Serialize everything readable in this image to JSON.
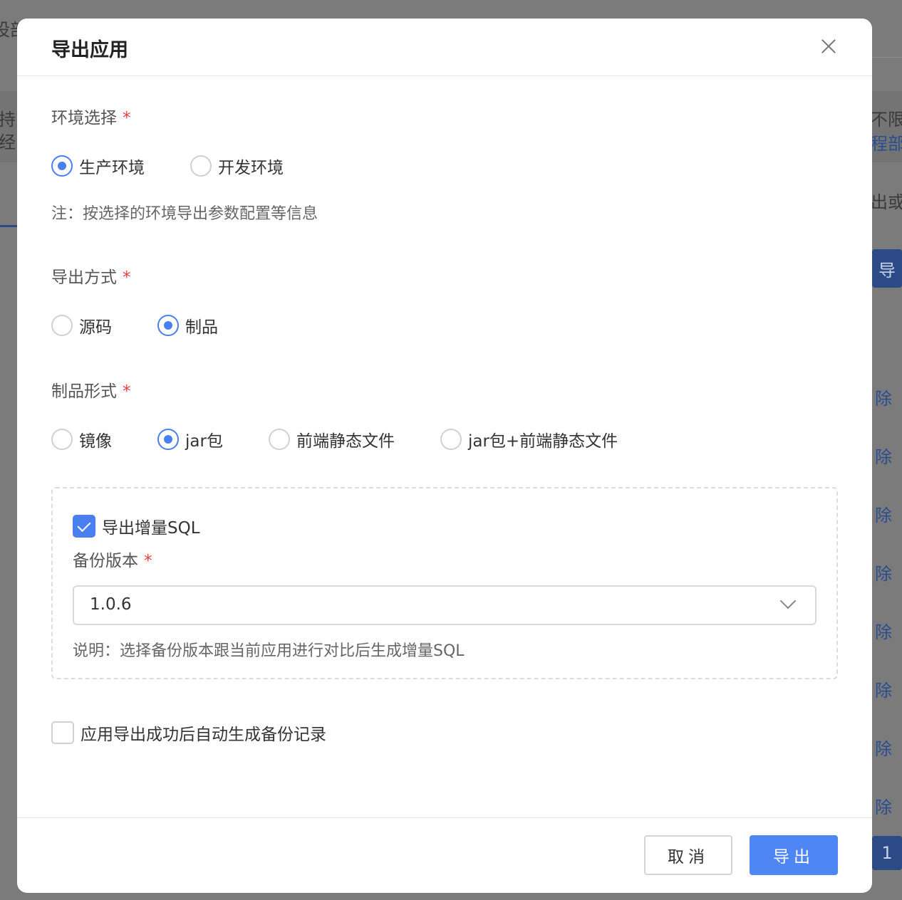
{
  "background": {
    "fragments": [
      "设部",
      "持",
      "经",
      "不限",
      "程部",
      "出或",
      "导",
      "除",
      "除",
      "除",
      "除",
      "除",
      "除",
      "除",
      "除",
      "1"
    ]
  },
  "modal": {
    "title": "导出应用",
    "env": {
      "label": "环境选择",
      "required": "*",
      "options": [
        {
          "label": "生产环境",
          "checked": true
        },
        {
          "label": "开发环境",
          "checked": false
        }
      ],
      "note": "注：按选择的环境导出参数配置等信息"
    },
    "export_method": {
      "label": "导出方式",
      "required": "*",
      "options": [
        {
          "label": "源码",
          "checked": false
        },
        {
          "label": "制品",
          "checked": true
        }
      ]
    },
    "artifact_form": {
      "label": "制品形式",
      "required": "*",
      "options": [
        {
          "label": "镜像",
          "checked": false
        },
        {
          "label": "jar包",
          "checked": true
        },
        {
          "label": "前端静态文件",
          "checked": false
        },
        {
          "label": "jar包+前端静态文件",
          "checked": false
        }
      ]
    },
    "incremental": {
      "checkbox_label": "导出增量SQL",
      "checked": true,
      "backup_label": "备份版本",
      "required": "*",
      "selected_version": "1.0.6",
      "note": "说明：选择备份版本跟当前应用进行对比后生成增量SQL"
    },
    "auto_backup": {
      "label": "应用导出成功后自动生成备份记录",
      "checked": false
    },
    "footer": {
      "cancel_label": "取消",
      "export_label": "导出"
    }
  },
  "colors": {
    "accent": "#4a7ff0",
    "required": "#e0413d",
    "primary_button": "#4e86f5"
  }
}
